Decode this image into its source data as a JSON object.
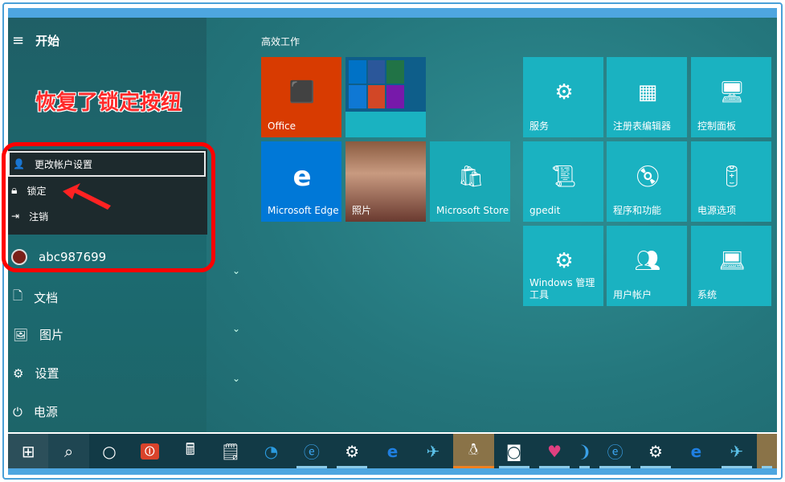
{
  "start": {
    "title": "开始",
    "annotation": "恢复了锁定按纽",
    "popup": [
      {
        "label": "更改帐户设置",
        "icon": "account-settings-icon"
      },
      {
        "label": "锁定",
        "icon": "lock-icon"
      },
      {
        "label": "注销",
        "icon": "sign-out-icon"
      }
    ],
    "user": "abc987699",
    "items": [
      {
        "label": "文档",
        "icon": "document-icon"
      },
      {
        "label": "图片",
        "icon": "picture-icon"
      },
      {
        "label": "设置",
        "icon": "gear-icon"
      },
      {
        "label": "电源",
        "icon": "power-icon"
      }
    ]
  },
  "tiles": {
    "group_title": "高效工作",
    "office": "Office",
    "edge": "Microsoft Edge",
    "photos": "照片",
    "store": "Microsoft Store",
    "admin": [
      "服务",
      "注册表编辑器",
      "控制面板",
      "gpedit",
      "程序和功能",
      "电源选项",
      "Windows 管理工具",
      "用户帐户",
      "系统"
    ]
  },
  "taskbar": [
    "start",
    "search",
    "cortana",
    "power-app",
    "calculator",
    "notepad",
    "browser",
    "ie",
    "settings",
    "edge",
    "kingfisher",
    "qq",
    "media",
    "gallery",
    "app",
    "ie",
    "settings",
    "edge",
    "kingfisher",
    "app"
  ],
  "colors": {
    "tile": "#1ab2c1",
    "office": "#d83b01",
    "edge": "#0078d7",
    "annotation": "#ff2a2a"
  }
}
